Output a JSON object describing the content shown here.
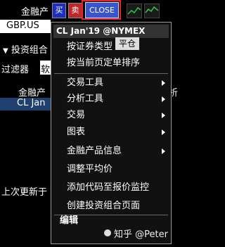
{
  "toolbar": {
    "product_label": "金融产",
    "buy_label": "买",
    "sell_label": "卖",
    "close_label": "CLOSE"
  },
  "background": {
    "security_field": "GBP.US",
    "portfolio_label": "投资组合",
    "filter_label": "过滤器",
    "filter_value": "软",
    "column_header": "金融产",
    "column_header_right": "析",
    "selected_row": "CL Jan",
    "status_text": "上次更新于"
  },
  "menu": {
    "title": "CL Jan'19 @NYMEX",
    "items": [
      {
        "label": "按证券类型"
      },
      {
        "label": "按当前页定单排序"
      },
      {
        "label": "交易工具"
      },
      {
        "label": "分析工具"
      },
      {
        "label": "交易"
      },
      {
        "label": "图表"
      },
      {
        "label": "金融产品信息"
      },
      {
        "label": "调整平均价"
      },
      {
        "label": "添加代码至报价监控"
      },
      {
        "label": "创建投资组合页面"
      },
      {
        "label": "编辑"
      }
    ],
    "tooltip": "平仓"
  },
  "watermark": "知乎 @Peter",
  "colors": {
    "buy": "#1d2fbf",
    "sell": "#c1262a",
    "close_button": "#3a55c8",
    "highlight_outline": "#e0262a"
  }
}
